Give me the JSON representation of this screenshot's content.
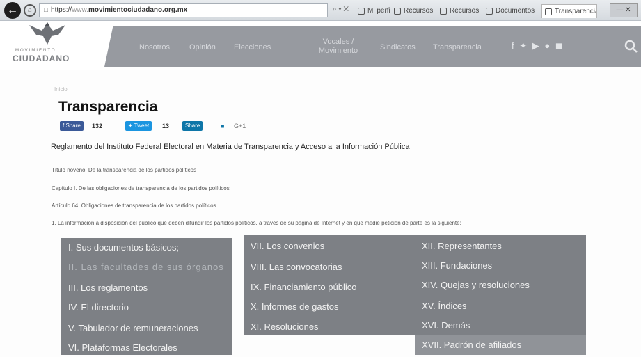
{
  "browser": {
    "address_prefix": "https://",
    "address_dim": "www.",
    "address_domain": "movimientociudadano.org.mx",
    "address_controls": "⌕ ▾ ✕",
    "tabs": [
      {
        "label": "Mi perfil"
      },
      {
        "label": "Recursos"
      },
      {
        "label": "Recursos"
      },
      {
        "label": "Documentos"
      },
      {
        "label": "Transparencia"
      }
    ],
    "window_controls": "— ✕"
  },
  "site": {
    "logo_line1": "MOVIMIENTO",
    "logo_line2": "CIUDADANO",
    "nav": [
      "Nosotros",
      "Opinión",
      "Elecciones",
      "Vocales / Movimiento",
      "Sindicatos",
      "Transparencia"
    ],
    "social": "f ✦ ▶ ● ◼"
  },
  "page": {
    "breadcrumb": "Inicio",
    "title": "Transparencia",
    "share": {
      "fb_label": "Share",
      "fb_count": "132",
      "tw_label": "Tweet",
      "tw_count": "13",
      "li_label": "Share",
      "gplus": "G+1"
    },
    "regulation_title": "Reglamento del Instituto Federal Electoral en Materia de Transparencia y Acceso a la Información Pública",
    "lines": [
      "Título noveno. De la transparencia de los partidos políticos",
      "Capítulo I. De las obligaciones de transparencia de los partidos políticos",
      "Artículo 64. Obligaciones de transparencia de los partidos políticos",
      "1. La información a disposición del público que deben difundir los partidos políticos, a través de su página de Internet y en que medie petición de parte es la siguiente:"
    ]
  },
  "panel": {
    "col1": [
      "I. Sus documentos básicos;",
      "II. Las facultades de sus órganos",
      "III. Los reglamentos",
      "IV. El directorio",
      "V. Tabulador de remuneraciones",
      "VI. Plataformas Electorales"
    ],
    "col2": [
      "VII. Los convenios",
      "VIII. Las convocatorias",
      "IX. Financiamiento público",
      "X. Informes de gastos",
      "XI. Resoluciones"
    ],
    "col3": [
      "XII. Representantes",
      "XIII. Fundaciones",
      "XIV. Quejas y resoluciones",
      "XV. Índices",
      "XVI. Demás",
      "XVII. Padrón de afiliados"
    ]
  }
}
